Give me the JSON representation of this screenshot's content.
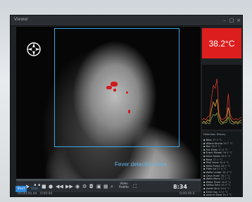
{
  "window": {
    "title": "Viewer"
  },
  "temperature": {
    "value": "38.2°C",
    "color": "#dd1e1e"
  },
  "detection": {
    "label": "Fever detection area",
    "box_color": "#36a8e6"
  },
  "controls": {
    "speed_line1": "Video",
    "speed_line2": "Palette",
    "time_start": "00:00:00.00",
    "time_mark": "0:00:00",
    "time_end": "0:00:00.0"
  },
  "list": {
    "header": "Detection History",
    "rows": [
      {
        "name": "Bliss",
        "val": "37.5 °C"
      },
      {
        "name": "Wilma Kinnia",
        "val": "36.7 °C"
      },
      {
        "name": "Rox",
        "val": "36.9 °C"
      },
      {
        "name": "Fex Hilmi",
        "val": "37.0 °C"
      },
      {
        "name": "Frank Mineal",
        "val": "36.5 °C"
      },
      {
        "name": "Kinla Stolle",
        "val": "36.8 °C"
      },
      {
        "name": "Roxa",
        "val": "37.1 °C"
      },
      {
        "name": "Peel Hune",
        "val": "36.6 °C"
      },
      {
        "name": "Kella Prend",
        "val": "36.9 °C"
      },
      {
        "name": "Fdek Sa",
        "val": "37.0 °C"
      },
      {
        "name": "Wella Linder",
        "val": "36.4 °C"
      },
      {
        "name": "Ceva Huml",
        "val": "36.7 °C"
      },
      {
        "name": "Wells Mons",
        "val": "37.2 °C"
      },
      {
        "name": "Wella Timel",
        "val": "36.8 °C"
      },
      {
        "name": "Seliba Sirm",
        "val": "36.9 °C"
      },
      {
        "name": "Sarfel Sinn",
        "val": "36.6 °C"
      },
      {
        "name": "Erthi Huy",
        "val": "37.0 °C"
      },
      {
        "name": "Jankrm Sleal",
        "val": "36.5 °C"
      }
    ]
  },
  "footer": {
    "start": "Start",
    "stop": "Stop",
    "clock": "8:34"
  },
  "graph": {
    "lines": [
      {
        "color": "#d43b2f",
        "values": [
          5,
          6,
          5,
          7,
          8,
          20,
          30,
          28,
          35,
          10,
          6,
          5,
          6,
          8,
          24,
          9,
          6,
          5,
          6,
          5,
          6,
          7
        ]
      },
      {
        "color": "#e8a23a",
        "values": [
          3,
          4,
          3,
          5,
          4,
          12,
          18,
          15,
          20,
          8,
          4,
          3,
          4,
          5,
          14,
          6,
          4,
          3,
          4,
          3,
          4,
          5
        ]
      },
      {
        "color": "#7e9c4c",
        "values": [
          2,
          3,
          2,
          3,
          2,
          6,
          9,
          8,
          10,
          4,
          2,
          2,
          3,
          3,
          7,
          3,
          2,
          2,
          3,
          2,
          3,
          3
        ]
      }
    ]
  }
}
